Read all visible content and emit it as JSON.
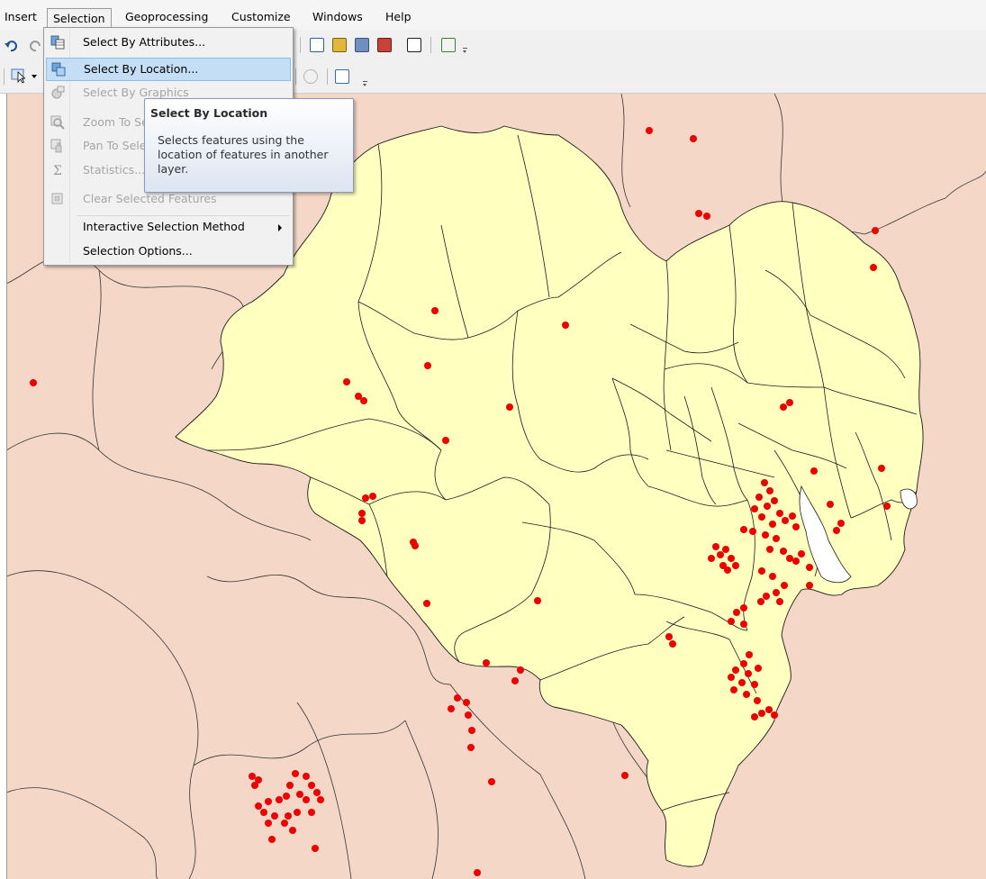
{
  "menubar": {
    "items": [
      "Insert",
      "Selection",
      "Geoprocessing",
      "Customize",
      "Windows",
      "Help"
    ],
    "active_index": 1
  },
  "selection_menu": {
    "items": [
      {
        "label": "Select By Attributes...",
        "enabled": true,
        "icon": "select-by-attributes-icon"
      },
      {
        "label": "Select By Location...",
        "enabled": true,
        "highlighted": true,
        "icon": "select-by-location-icon"
      },
      {
        "label": "Select By Graphics",
        "enabled": false,
        "icon": "select-by-graphics-icon"
      },
      {
        "label": "Zoom To Selected Features",
        "enabled": false,
        "icon": "zoom-to-selected-icon"
      },
      {
        "label": "Pan To Selected Features",
        "enabled": false,
        "icon": "pan-to-selected-icon"
      },
      {
        "label": "Statistics...",
        "enabled": false,
        "icon": "statistics-sigma-icon"
      },
      {
        "label": "Clear Selected Features",
        "enabled": false,
        "icon": "clear-selection-icon"
      },
      {
        "label": "Interactive Selection Method",
        "enabled": true,
        "submenu": true
      },
      {
        "label": "Selection Options...",
        "enabled": true
      }
    ]
  },
  "tooltip": {
    "title": "Select By Location",
    "body": "Selects features using the location of features in another layer."
  },
  "map": {
    "colors": {
      "background": "#f4d7c7",
      "study_area": "#ffffc0",
      "boundary": "#222222",
      "points": "#ee0000"
    }
  }
}
